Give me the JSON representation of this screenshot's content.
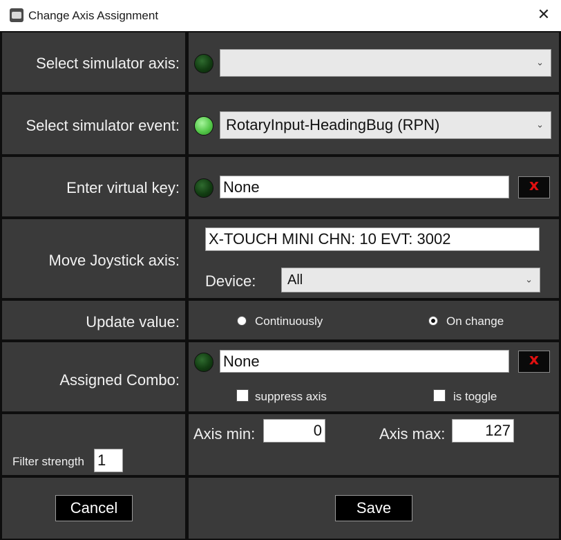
{
  "window": {
    "title": "Change Axis Assignment",
    "icon": "app-icon",
    "close_icon": "close-icon"
  },
  "simulator_axis": {
    "label": "Select simulator axis:",
    "led_state": "off",
    "selected": ""
  },
  "simulator_event": {
    "label": "Select simulator event:",
    "led_state": "on",
    "selected": "RotaryInput-HeadingBug (RPN)"
  },
  "virtual_key": {
    "label": "Enter virtual key:",
    "led_state": "off",
    "value": "None",
    "clear_label": "x"
  },
  "joystick": {
    "label": "Move Joystick axis:",
    "axis_value": "X-TOUCH MINI CHN: 10 EVT: 3002",
    "device_label": "Device:",
    "device_selected": "All"
  },
  "update_value": {
    "label": "Update value:",
    "options": [
      {
        "label": "Continuously",
        "checked": false
      },
      {
        "label": "On change",
        "checked": true
      }
    ]
  },
  "combo": {
    "label": "Assigned Combo:",
    "led_state": "off",
    "value": "None",
    "clear_label": "x",
    "suppress_axis_label": "suppress axis",
    "suppress_axis_checked": false,
    "is_toggle_label": "is toggle",
    "is_toggle_checked": false
  },
  "filter": {
    "label": "Filter strength",
    "value": "1",
    "axis_min_label": "Axis min:",
    "axis_min_value": "0",
    "axis_max_label": "Axis max:",
    "axis_max_value": "127"
  },
  "buttons": {
    "cancel": "Cancel",
    "save": "Save"
  },
  "colors": {
    "panel": "#3a3a3a",
    "grid": "#0e0e0e",
    "led_on": "#55c84a",
    "led_off": "#123d12",
    "clear_x": "#e01010"
  }
}
